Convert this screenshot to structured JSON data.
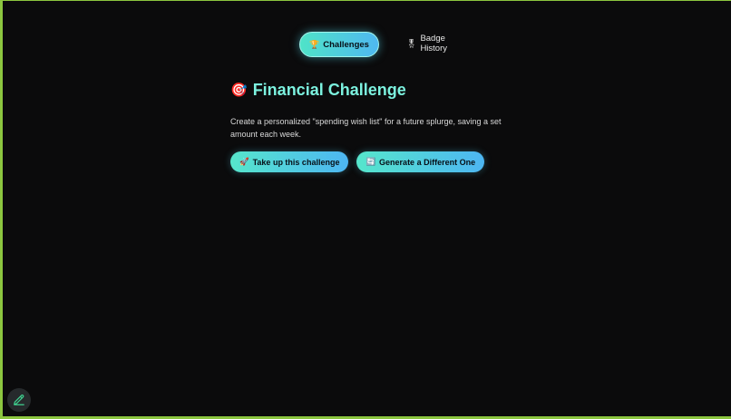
{
  "tabs": [
    {
      "label": "Challenges",
      "icon": "trophy-icon",
      "glyph": "🏆",
      "active": true
    },
    {
      "label": "Badge History",
      "icon": "medal-icon",
      "glyph": "🎖",
      "active": false
    }
  ],
  "challenge": {
    "title": "Financial Challenge",
    "title_icon": "target-icon",
    "title_glyph": "🎯",
    "description": "Create a personalized \"spending wish list\" for a future splurge, saving a set amount each week."
  },
  "actions": {
    "take_up": {
      "label": "Take up this challenge",
      "icon": "rocket-icon",
      "glyph": "🚀"
    },
    "generate": {
      "label": "Generate a Different One",
      "icon": "refresh-icon",
      "glyph": "🔄"
    }
  },
  "edit_button": {
    "icon": "pencil-icon"
  },
  "colors": {
    "background": "#0b0b0c",
    "accent": "#7cf2df",
    "gradient_start": "#4fe3c8",
    "gradient_end": "#4fb8f0",
    "border": "#8cc63f"
  }
}
